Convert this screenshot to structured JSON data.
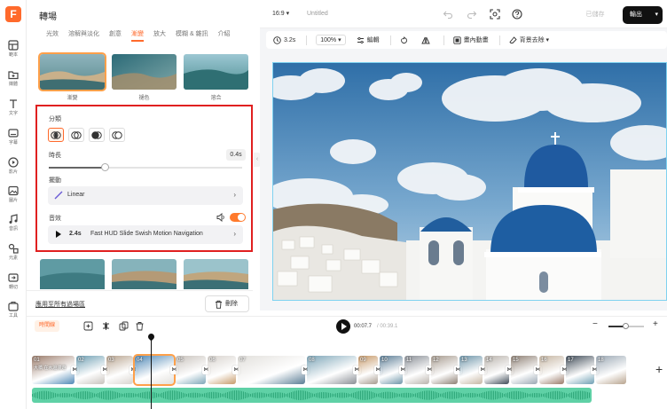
{
  "rail": {
    "items": [
      {
        "label": "範本",
        "icon": "template-icon"
      },
      {
        "label": "媒體",
        "icon": "media-icon"
      },
      {
        "label": "文字",
        "icon": "text-icon"
      },
      {
        "label": "字幕",
        "icon": "subtitle-icon"
      },
      {
        "label": "影片",
        "icon": "video-icon"
      },
      {
        "label": "圖片",
        "icon": "image-icon"
      },
      {
        "label": "音訊",
        "icon": "audio-icon"
      },
      {
        "label": "元素",
        "icon": "elements-icon"
      },
      {
        "label": "轉切",
        "icon": "transition-icon"
      },
      {
        "label": "工具",
        "icon": "tools-icon"
      }
    ]
  },
  "panel": {
    "title": "轉場",
    "tabs": [
      "光效",
      "溶解與淡化",
      "創意",
      "漸變",
      "放大",
      "模糊 & 雜訊",
      "介紹"
    ],
    "active_tab": 3,
    "thumbs_row1": [
      "漸變",
      "褪色",
      "溶合"
    ],
    "category_label": "分類",
    "duration_label": "時長",
    "duration_value": "0.4s",
    "duration_fraction": 0.29,
    "easing_label": "擺動",
    "easing_value": "Linear",
    "sound_label": "音效",
    "sound_enabled": true,
    "sound_duration": "2.4s",
    "sound_name": "Fast HUD Slide Swish Motion Navigation",
    "apply_all": "應用至所有過場區",
    "delete": "刪除"
  },
  "topbar": {
    "ratio": "16:9",
    "title": "Untitled",
    "saved": "已儲存",
    "export": "輸出"
  },
  "toolbar": {
    "duration": "3.2s",
    "zoom": "100%",
    "trim": "編輯",
    "motion": "畫內動畫",
    "bg_remove": "背景去除"
  },
  "timeline": {
    "label": "時間線",
    "current_time": "00:07.7",
    "total_time": "/ 00:39.1",
    "clip_numbers": [
      "01",
      "02",
      "03",
      "04",
      "05",
      "06",
      "07",
      "08",
      "09",
      "10",
      "11",
      "12",
      "13",
      "14",
      "15",
      "16",
      "17",
      "18"
    ],
    "selected_clip": "04",
    "clip_caption": "大橋 在水邊漫遊"
  },
  "colors": {
    "accent": "#ff6a2c",
    "selection": "#ffa04a",
    "highlight_box": "#e02020",
    "audio_track": "#5fd1a6"
  }
}
